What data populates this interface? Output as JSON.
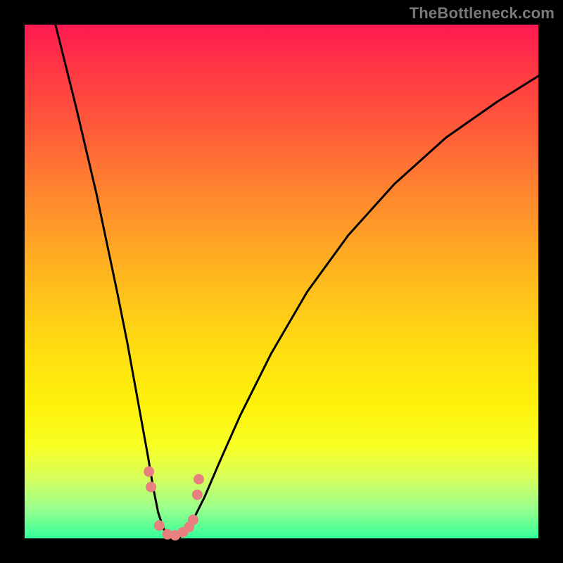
{
  "watermark": "TheBottleneck.com",
  "colors": {
    "frame": "#000000",
    "curve": "#000000",
    "marker": "#e98080",
    "gradient_top": "#ff1a52",
    "gradient_bottom": "#34ff9a"
  },
  "chart_data": {
    "type": "line",
    "title": "",
    "xlabel": "",
    "ylabel": "",
    "ylim": [
      0,
      100
    ],
    "xlim": [
      0,
      100
    ],
    "series": [
      {
        "name": "bottleneck-curve",
        "x": [
          6,
          10,
          14,
          18,
          20,
          22,
          24,
          25,
          26,
          27,
          28,
          29,
          30,
          31,
          32,
          33,
          35,
          38,
          42,
          48,
          55,
          63,
          72,
          82,
          92,
          100
        ],
        "values": [
          100,
          84,
          67,
          48,
          38,
          27,
          16,
          10,
          5,
          2,
          0,
          0,
          0,
          1,
          2,
          4,
          8,
          15,
          24,
          36,
          48,
          59,
          69,
          78,
          85,
          90
        ]
      }
    ],
    "markers": [
      {
        "x": 24.2,
        "y": 13
      },
      {
        "x": 24.6,
        "y": 10
      },
      {
        "x": 26.2,
        "y": 2.5
      },
      {
        "x": 27.8,
        "y": 0.8
      },
      {
        "x": 29.3,
        "y": 0.6
      },
      {
        "x": 30.8,
        "y": 1.2
      },
      {
        "x": 32.0,
        "y": 2.2
      },
      {
        "x": 32.8,
        "y": 3.6
      },
      {
        "x": 33.6,
        "y": 8.5
      },
      {
        "x": 33.9,
        "y": 11.5
      }
    ],
    "marker_radius_px": 7.5
  }
}
